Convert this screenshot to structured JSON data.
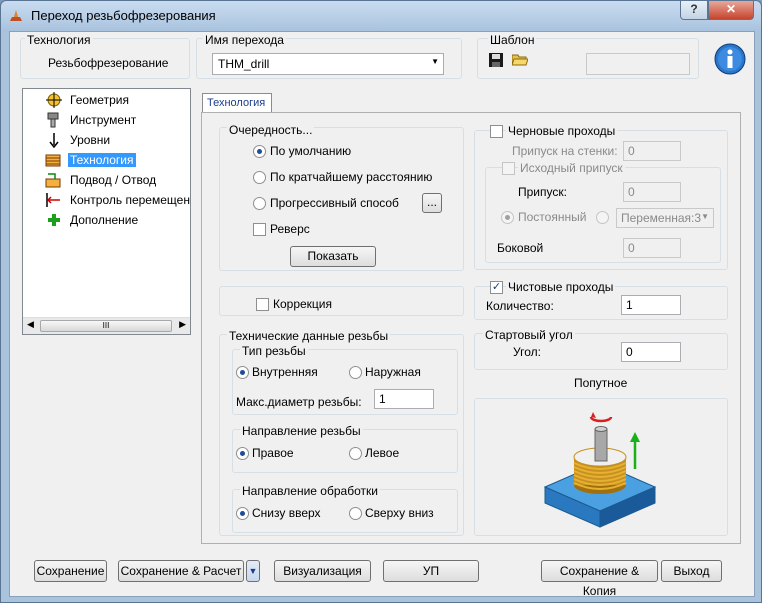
{
  "window": {
    "title": "Переход резьбофрезерования",
    "help_glyph": "?",
    "close_glyph": "✕"
  },
  "header": {
    "technology_label": "Технология",
    "technology_value": "Резьбофрезерование",
    "operation_name_label": "Имя перехода",
    "operation_name_value": "THM_drill",
    "template_label": "Шаблон"
  },
  "tree": {
    "items": [
      {
        "label": "Геометрия",
        "icon": "crosshair-icon"
      },
      {
        "label": "Инструмент",
        "icon": "tool-holder-icon"
      },
      {
        "label": "Уровни",
        "icon": "levels-icon"
      },
      {
        "label": "Технология",
        "icon": "technology-icon"
      },
      {
        "label": "Подвод / Отвод",
        "icon": "approach-icon"
      },
      {
        "label": "Контроль перемещен",
        "icon": "motion-control-icon"
      },
      {
        "label": "Дополнение",
        "icon": "plus-icon"
      }
    ],
    "scroll_grip": "III"
  },
  "tab": {
    "label": "Технология"
  },
  "order": {
    "title": "Очередность...",
    "options": [
      "По умолчанию",
      "По кратчайшему расстоянию",
      "Прогрессивный способ"
    ],
    "selected": 0,
    "more_button": "...",
    "reverse_label": "Реверс",
    "show_button": "Показать"
  },
  "rough": {
    "title": "Черновые проходы",
    "wall_allowance_label": "Припуск на стенки:",
    "wall_allowance_value": "0",
    "initial_allowance_label": "Исходный припуск",
    "allowance_label": "Припуск:",
    "allowance_value": "0",
    "constant_label": "Постоянный",
    "variable_value": "Переменная:3",
    "side_label": "Боковой",
    "side_value": "0"
  },
  "correction": {
    "label": "Коррекция"
  },
  "finish": {
    "title": "Чистовые проходы",
    "checked": true,
    "count_label": "Количество:",
    "count_value": "1"
  },
  "thread": {
    "title": "Технические данные резьбы",
    "type_title": "Тип резьбы",
    "internal_label": "Внутренняя",
    "external_label": "Наружная",
    "max_diam_label": "Макс.диаметр резьбы:",
    "max_diam_value": "1",
    "direction_title": "Направление резьбы",
    "right_label": "Правое",
    "left_label": "Левое",
    "machining_title": "Направление обработки",
    "bottom_up_label": "Снизу вверх",
    "top_down_label": "Сверху вниз"
  },
  "start_angle": {
    "title": "Стартовый угол",
    "angle_label": "Угол:",
    "angle_value": "0"
  },
  "preview": {
    "caption": "Попутное"
  },
  "footer": {
    "save": "Сохранение",
    "save_calc": "Сохранение & Расчет",
    "visualize": "Визуализация",
    "nc": "УП",
    "save_copy": "Сохранение & Копия",
    "exit": "Выход"
  },
  "colors": {
    "selection": "#3399ff",
    "tab_text": "#1b3c8c",
    "radio_dot": "#1c4c9c"
  }
}
